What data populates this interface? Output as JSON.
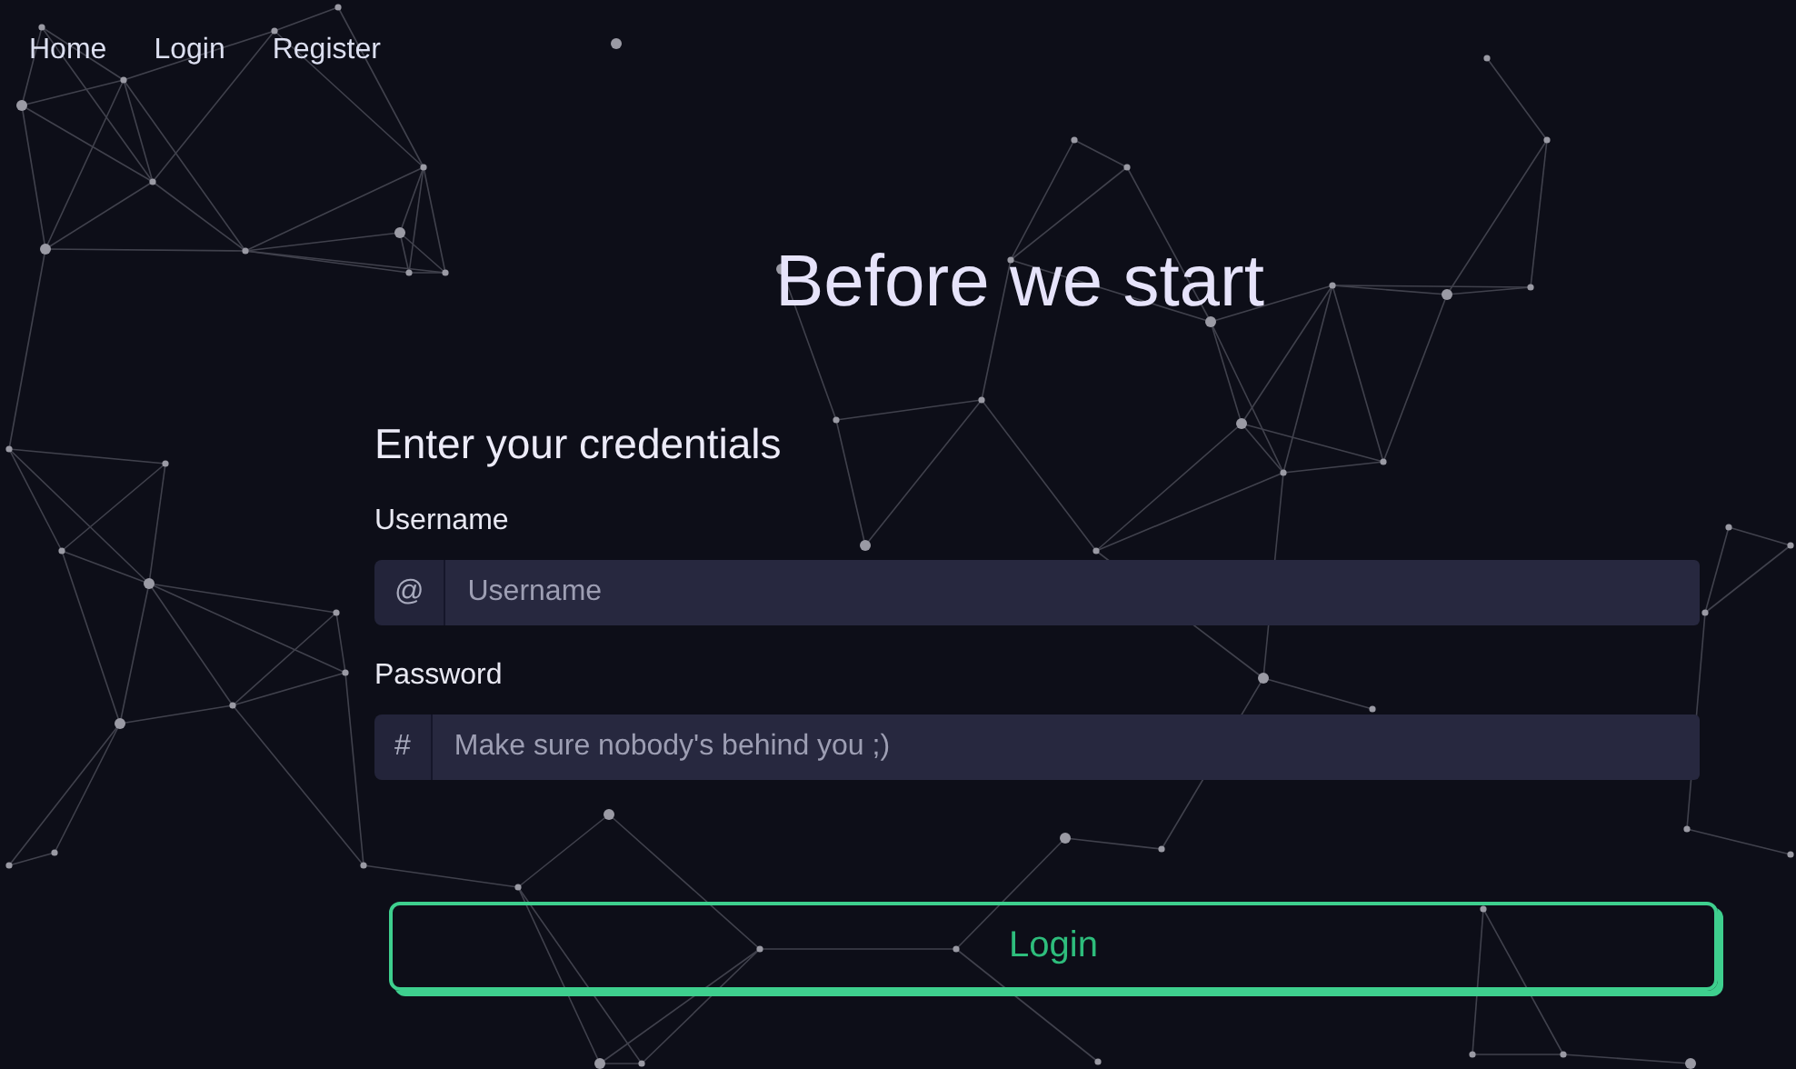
{
  "nav": [
    {
      "label": "Home"
    },
    {
      "label": "Login"
    },
    {
      "label": "Register"
    }
  ],
  "title": "Before we start",
  "form": {
    "heading": "Enter your credentials",
    "fields": [
      {
        "label": "Username",
        "prefix": "@",
        "placeholder": "Username"
      },
      {
        "label": "Password",
        "prefix": "#",
        "placeholder": "Make sure nobody's behind you ;)"
      }
    ],
    "submit": "Login"
  }
}
